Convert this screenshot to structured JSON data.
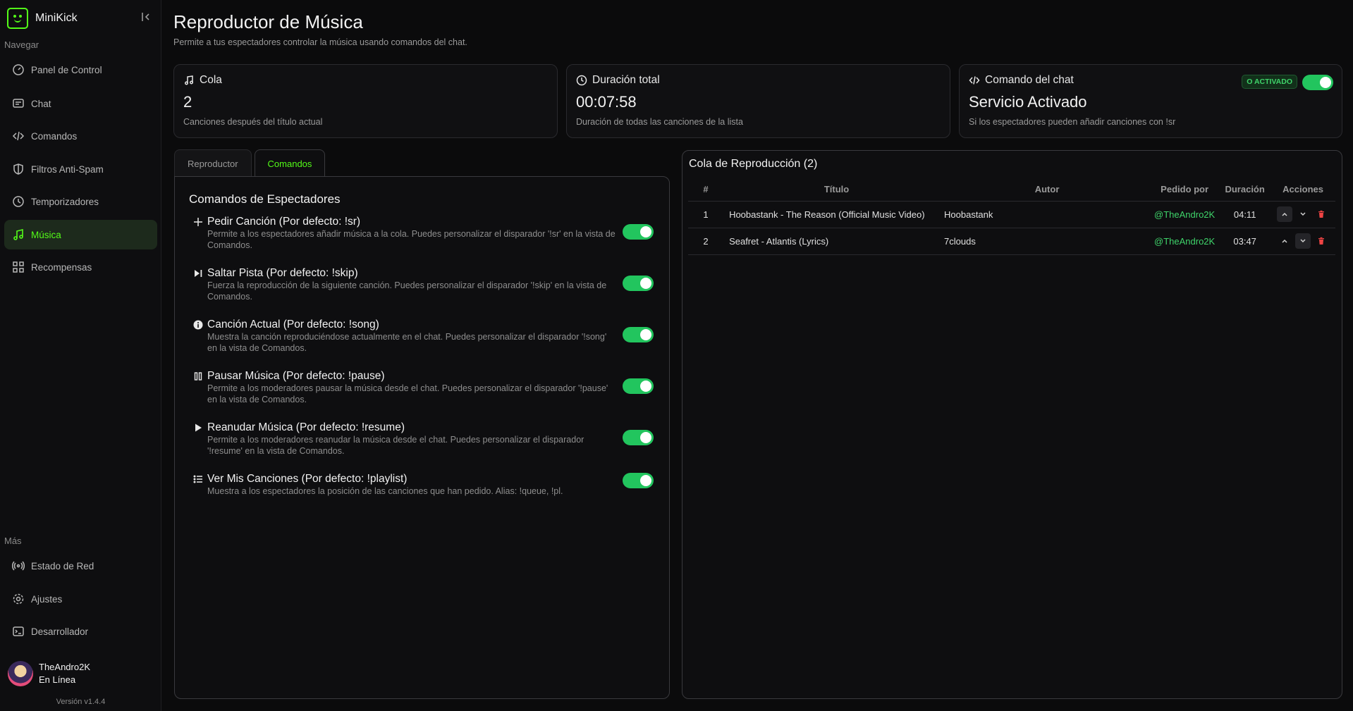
{
  "app": {
    "name": "MiniKick",
    "version": "Versión v1.4.4"
  },
  "sidebar": {
    "nav_label": "Navegar",
    "items": [
      {
        "label": "Panel de Control",
        "icon": "gauge-icon"
      },
      {
        "label": "Chat",
        "icon": "chat-icon"
      },
      {
        "label": "Comandos",
        "icon": "code-icon"
      },
      {
        "label": "Filtros Anti-Spam",
        "icon": "shield-icon"
      },
      {
        "label": "Temporizadores",
        "icon": "clock-icon"
      },
      {
        "label": "Música",
        "icon": "music-icon",
        "active": true
      },
      {
        "label": "Recompensas",
        "icon": "grid-icon"
      }
    ],
    "more_label": "Más",
    "more_items": [
      {
        "label": "Estado de Red",
        "icon": "radio-icon"
      },
      {
        "label": "Ajustes",
        "icon": "gear-icon"
      },
      {
        "label": "Desarrollador",
        "icon": "terminal-icon"
      }
    ],
    "user": {
      "name": "TheAndro2K",
      "status": "En Línea"
    }
  },
  "header": {
    "title": "Reproductor de Música",
    "subtitle": "Permite a tus espectadores controlar la música usando comandos del chat."
  },
  "cards": {
    "queue": {
      "title": "Cola",
      "value": "2",
      "sub": "Canciones después del título actual"
    },
    "duration": {
      "title": "Duración total",
      "value": "00:07:58",
      "sub": "Duración de todas las canciones de la lista"
    },
    "command": {
      "title": "Comando del chat",
      "badge": "O ACTIVADO",
      "value": "Servicio Activado",
      "sub": "Si los espectadores pueden añadir canciones con !sr",
      "enabled": true
    }
  },
  "tabs": [
    {
      "label": "Reproductor"
    },
    {
      "label": "Comandos",
      "active": true
    }
  ],
  "commands_panel": {
    "title": "Comandos de Espectadores",
    "commands": [
      {
        "title": "Pedir Canción (Por defecto: !sr)",
        "desc": "Permite a los espectadores añadir música a la cola. Puedes personalizar el disparador '!sr' en la vista de Comandos.",
        "enabled": true
      },
      {
        "title": "Saltar Pista (Por defecto: !skip)",
        "desc": "Fuerza la reproducción de la siguiente canción. Puedes personalizar el disparador '!skip' en la vista de Comandos.",
        "enabled": true
      },
      {
        "title": "Canción Actual (Por defecto: !song)",
        "desc": "Muestra la canción reproduciéndose actualmente en el chat. Puedes personalizar el disparador '!song' en la vista de Comandos.",
        "enabled": true
      },
      {
        "title": "Pausar Música (Por defecto: !pause)",
        "desc": "Permite a los moderadores pausar la música desde el chat. Puedes personalizar el disparador '!pause' en la vista de Comandos.",
        "enabled": true
      },
      {
        "title": "Reanudar Música (Por defecto: !resume)",
        "desc": "Permite a los moderadores reanudar la música desde el chat. Puedes personalizar el disparador '!resume' en la vista de Comandos.",
        "enabled": true
      },
      {
        "title": "Ver Mis Canciones (Por defecto: !playlist)",
        "desc": "Muestra a los espectadores la posición de las canciones que han pedido. Alias: !queue, !pl.",
        "enabled": true
      }
    ]
  },
  "queue_panel": {
    "title": "Cola de Reproducción (2)",
    "columns": [
      "#",
      "Título",
      "Autor",
      "Pedido por",
      "Duración",
      "Acciones"
    ],
    "rows": [
      {
        "num": "1",
        "title": "Hoobastank - The Reason (Official Music Video)",
        "author": "Hoobastank",
        "requested_by": "@TheAndro2K",
        "duration": "04:11"
      },
      {
        "num": "2",
        "title": "Seafret - Atlantis (Lyrics)",
        "author": "7clouds",
        "requested_by": "@TheAndro2K",
        "duration": "03:47"
      }
    ]
  },
  "colors": {
    "accent": "#53fc18",
    "toggle_on": "#22c55e",
    "danger": "#ef4444"
  }
}
